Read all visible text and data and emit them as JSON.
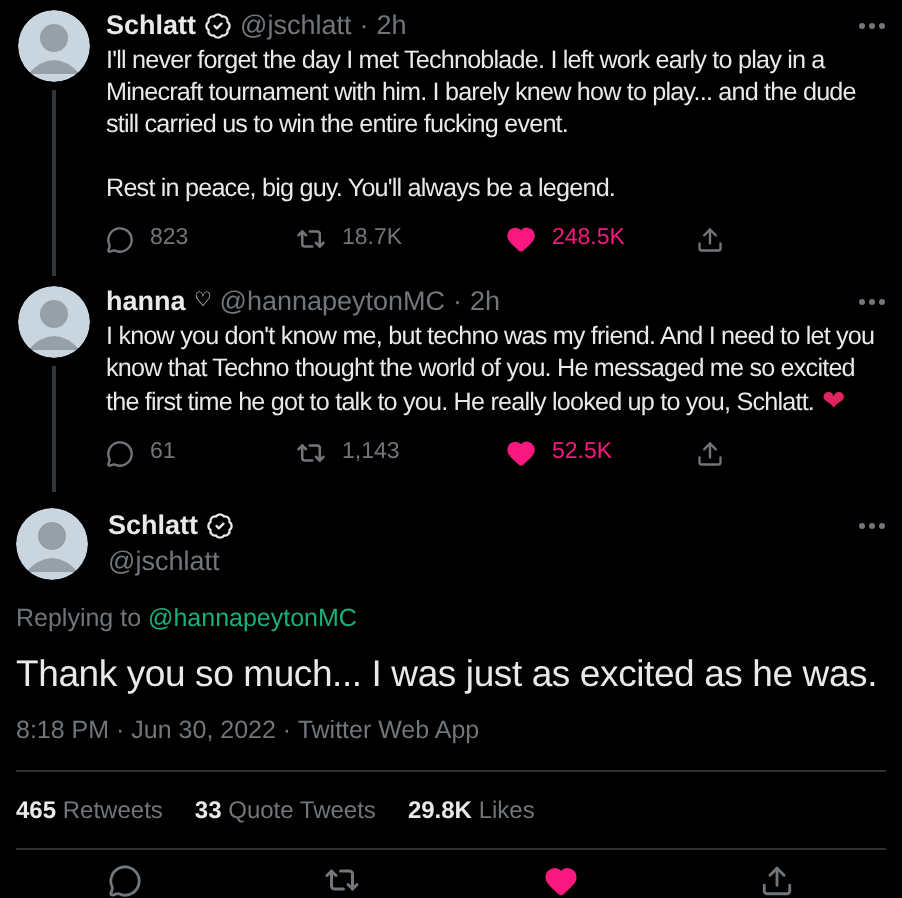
{
  "thread": [
    {
      "name": "Schlatt",
      "verified": true,
      "handle": "@jschlatt",
      "dot": "·",
      "time": "2h",
      "paragraphs": [
        "I'll never forget the day I met Technoblade. I left work early to play in a Minecraft tournament with him. I barely knew how to play... and the dude still carried us to win the entire fucking event.",
        "Rest in peace, big guy. You'll always be a legend."
      ],
      "replies": "823",
      "retweets": "18.7K",
      "likes": "248.5K",
      "liked": true
    },
    {
      "name": "hanna",
      "verified": false,
      "name_symbol": "♡",
      "handle": "@hannapeytonMC",
      "dot": "·",
      "time": "2h",
      "paragraphs": [
        "I know you don't know me, but techno was my friend. And I need to let you know that Techno thought the world of you. He messaged me so excited the first time he got to talk to you. He really looked up to you, Schlatt."
      ],
      "end_emoji": "❤",
      "replies": "61",
      "retweets": "1,143",
      "likes": "52.5K",
      "liked": true
    }
  ],
  "main": {
    "name": "Schlatt",
    "verified": true,
    "handle": "@jschlatt",
    "replying_label": "Replying to",
    "replying_to": "@hannapeytonMC",
    "text": "Thank you so much... I was just as excited as he was.",
    "meta": "8:18 PM · Jun 30, 2022 · Twitter Web App",
    "stats": [
      {
        "count": "465",
        "label": "Retweets"
      },
      {
        "count": "33",
        "label": "Quote Tweets"
      },
      {
        "count": "29.8K",
        "label": "Likes"
      }
    ],
    "liked": true
  }
}
